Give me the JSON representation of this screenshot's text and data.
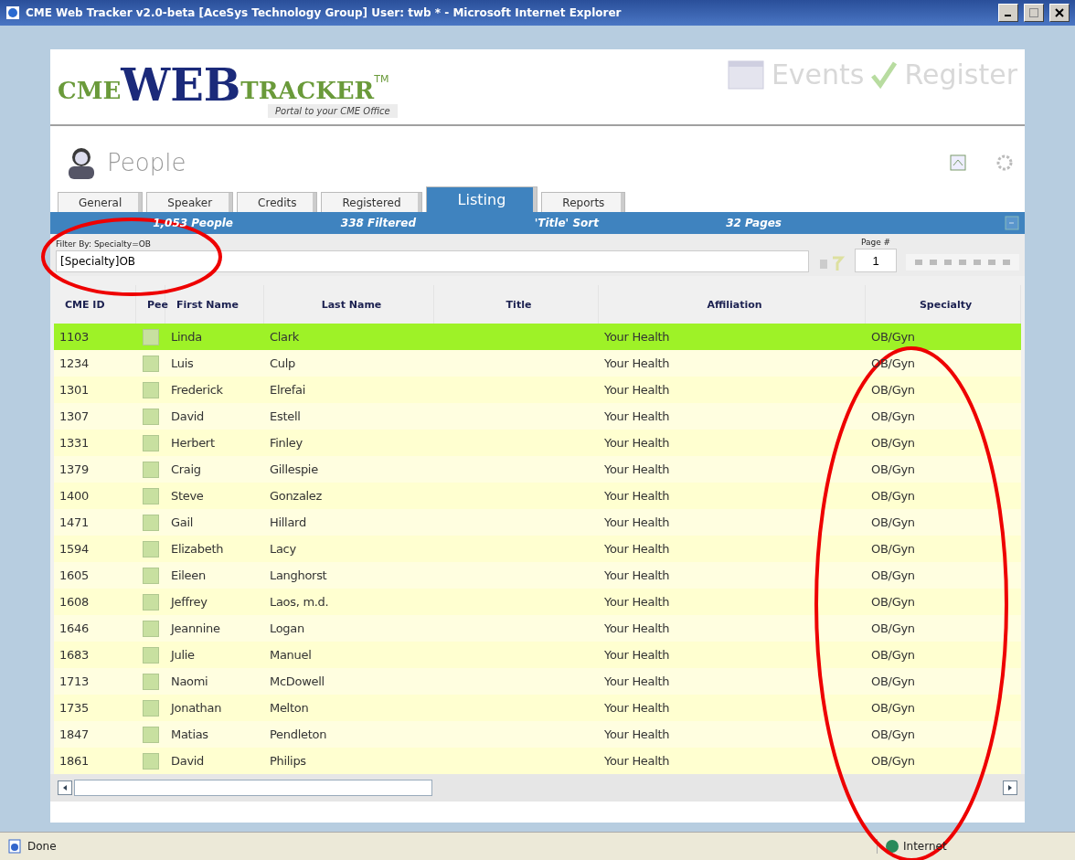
{
  "window": {
    "title": "CME Web Tracker v2.0-beta [AceSys Technology Group] User: twb * - Microsoft Internet Explorer"
  },
  "header": {
    "logo_left": "CME",
    "logo_main": "WEB",
    "logo_right": "TRACKER",
    "trademark": "TM",
    "tagline": "Portal to your CME Office",
    "links": [
      "Events",
      "Register"
    ]
  },
  "section": {
    "title": "People"
  },
  "tabs": [
    {
      "label": "General",
      "selected": false
    },
    {
      "label": "Speaker",
      "selected": false
    },
    {
      "label": "Credits",
      "selected": false
    },
    {
      "label": "Registered",
      "selected": false
    },
    {
      "label": "Listing",
      "selected": true
    },
    {
      "label": "Reports",
      "selected": false
    }
  ],
  "summary": [
    "1,053 People",
    "338 Filtered",
    "'Title' Sort",
    "32 Pages"
  ],
  "filter": {
    "label": "Filter By: Specialty=OB",
    "value": "[Specialty]OB"
  },
  "page": {
    "label": "Page #",
    "value": "1"
  },
  "table": {
    "columns": [
      "CME ID",
      "Pee",
      "First Name",
      "Last Name",
      "Title",
      "Affiliation",
      "Specialty"
    ],
    "rows": [
      {
        "selected": true,
        "cells": [
          "1103",
          "",
          "Linda",
          "Clark",
          "",
          "Your Health",
          "OB/Gyn"
        ]
      },
      {
        "selected": false,
        "cells": [
          "1234",
          "",
          "Luis",
          "Culp",
          "",
          "Your Health",
          "OB/Gyn"
        ]
      },
      {
        "selected": false,
        "cells": [
          "1301",
          "",
          "Frederick",
          "Elrefai",
          "",
          "Your Health",
          "OB/Gyn"
        ]
      },
      {
        "selected": false,
        "cells": [
          "1307",
          "",
          "David",
          "Estell",
          "",
          "Your Health",
          "OB/Gyn"
        ]
      },
      {
        "selected": false,
        "cells": [
          "1331",
          "",
          "Herbert",
          "Finley",
          "",
          "Your Health",
          "OB/Gyn"
        ]
      },
      {
        "selected": false,
        "cells": [
          "1379",
          "",
          "Craig",
          "Gillespie",
          "",
          "Your Health",
          "OB/Gyn"
        ]
      },
      {
        "selected": false,
        "cells": [
          "1400",
          "",
          "Steve",
          "Gonzalez",
          "",
          "Your Health",
          "OB/Gyn"
        ]
      },
      {
        "selected": false,
        "cells": [
          "1471",
          "",
          "Gail",
          "Hillard",
          "",
          "Your Health",
          "OB/Gyn"
        ]
      },
      {
        "selected": false,
        "cells": [
          "1594",
          "",
          "Elizabeth",
          "Lacy",
          "",
          "Your Health",
          "OB/Gyn"
        ]
      },
      {
        "selected": false,
        "cells": [
          "1605",
          "",
          "Eileen",
          "Langhorst",
          "",
          "Your Health",
          "OB/Gyn"
        ]
      },
      {
        "selected": false,
        "cells": [
          "1608",
          "",
          "Jeffrey",
          "Laos, m.d.",
          "",
          "Your Health",
          "OB/Gyn"
        ]
      },
      {
        "selected": false,
        "cells": [
          "1646",
          "",
          "Jeannine",
          "Logan",
          "",
          "Your Health",
          "OB/Gyn"
        ]
      },
      {
        "selected": false,
        "cells": [
          "1683",
          "",
          "Julie",
          "Manuel",
          "",
          "Your Health",
          "OB/Gyn"
        ]
      },
      {
        "selected": false,
        "cells": [
          "1713",
          "",
          "Naomi",
          "McDowell",
          "",
          "Your Health",
          "OB/Gyn"
        ]
      },
      {
        "selected": false,
        "cells": [
          "1735",
          "",
          "Jonathan",
          "Melton",
          "",
          "Your Health",
          "OB/Gyn"
        ]
      },
      {
        "selected": false,
        "cells": [
          "1847",
          "",
          "Matias",
          "Pendleton",
          "",
          "Your Health",
          "OB/Gyn"
        ]
      },
      {
        "selected": false,
        "cells": [
          "1861",
          "",
          "David",
          "Philips",
          "",
          "Your Health",
          "OB/Gyn"
        ]
      }
    ]
  },
  "status_bar": {
    "text": "Done",
    "zone": "Internet"
  }
}
